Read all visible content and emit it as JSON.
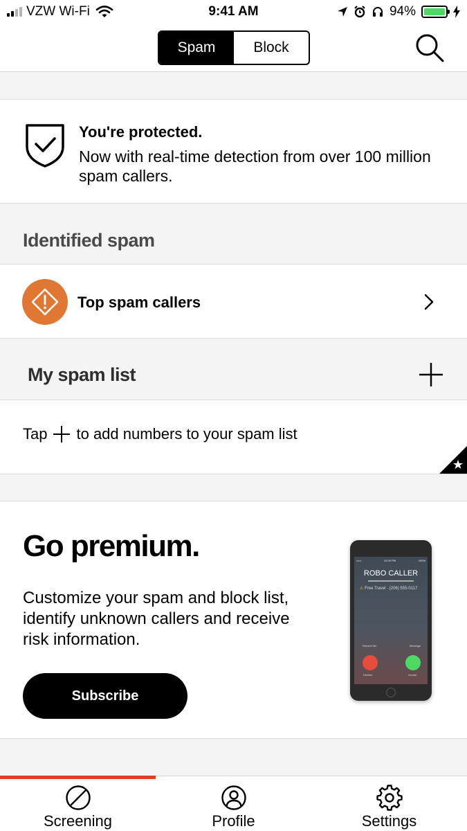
{
  "status_bar": {
    "carrier": "VZW Wi-Fi",
    "time": "9:41 AM",
    "battery": "94%"
  },
  "nav": {
    "segments": [
      "Spam",
      "Block"
    ],
    "active_segment": "Spam"
  },
  "protected": {
    "title": "You're protected.",
    "text": "Now with real-time detection from over 100 million spam callers."
  },
  "identified_spam": {
    "heading": "Identified spam",
    "item_label": "Top spam callers"
  },
  "my_spam_list": {
    "heading": "My spam list",
    "hint_before": "Tap",
    "hint_after": "to add numbers to your spam list"
  },
  "premium": {
    "title": "Go premium.",
    "text": "Customize your spam and block list, identify unknown callers and receive risk information.",
    "button": "Subscribe",
    "phone": {
      "status_left": "•••••",
      "status_time": "12:00 PM",
      "status_right": "100%",
      "caller": "ROBO CALLER",
      "subtitle": "Free Travel · (206) 555-0117",
      "remind": "Remind Me",
      "message": "Message",
      "decline": "Decline",
      "accept": "Accept"
    }
  },
  "tabs": [
    {
      "label": "Screening",
      "icon": "no-sign-icon"
    },
    {
      "label": "Profile",
      "icon": "person-icon"
    },
    {
      "label": "Settings",
      "icon": "gear-icon"
    }
  ],
  "colors": {
    "accent": "#e53a23",
    "warning": "#e07834",
    "battery": "#4cd964"
  }
}
